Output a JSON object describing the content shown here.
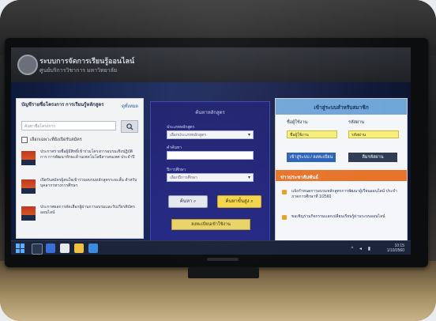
{
  "colors": {
    "center_panel": "#262a86",
    "right_header": "#6fa6d8",
    "orange_bar": "#e8742a",
    "yellow_button": "#f3d54a",
    "taskbar": "#1b2438"
  },
  "site": {
    "title": "ระบบการจัดการเรียนรู้ออนไลน์",
    "subtitle": "ศูนย์บริการวิชาการ มหาวิทยาลัย"
  },
  "left_panel": {
    "title": "บัญชีรายชื่อโครงการ การเรียนรู้หลักสูตร",
    "link": "ดูทั้งหมด",
    "search_placeholder": "ค้นหาชื่อโครงการ",
    "search_icon": "magnifier-icon",
    "checkbox_label": "เลือกเฉพาะที่ยังเปิดรับสมัคร",
    "news": [
      {
        "text": "ประกาศรายชื่อผู้มีสิทธิ์เข้าร่วมโครงการอบรมเชิงปฏิบัติการ การพัฒนาทักษะด้านเทคโนโลยีสารสนเทศ ประจำปี"
      },
      {
        "text": "เปิดรับสมัครผู้สนใจเข้าร่วมอบรมหลักสูตรระยะสั้น สำหรับบุคลากรทางการศึกษา"
      },
      {
        "text": "ประกาศผลการคัดเลือกผู้ผ่านการอบรมและรับเกียรติบัตรออนไลน์"
      }
    ]
  },
  "center_panel": {
    "title": "ค้นหาหลักสูตร",
    "label_category": "ประเภทหลักสูตร",
    "select_category": "เลือกประเภทหลักสูตร",
    "label_keyword": "คำค้นหา",
    "label_year": "ปีการศึกษา",
    "select_year": "เลือกปีการศึกษา",
    "search_button": "ค้นหา",
    "advanced_button": "ค้นหาขั้นสูง",
    "register_button": "ลงทะเบียนเข้าใช้งาน"
  },
  "right_panel": {
    "title": "เข้าสู่ระบบสำหรับสมาชิก",
    "username_label": "ชื่อผู้ใช้งาน",
    "password_label": "รหัสผ่าน",
    "username_value": "ชื่อผู้ใช้งาน",
    "password_value": "รหัสผ่าน",
    "login_button": "เข้าสู่ระบบ / ลงทะเบียน",
    "forgot_button": "ลืมรหัสผ่าน",
    "bar_title": "ข่าวประชาสัมพันธ์",
    "items": [
      {
        "text": "แจ้งกำหนดการอบรมหลักสูตรการพัฒนาผู้เรียนออนไลน์ ประจำภาคการศึกษาที่ 1/2560"
      },
      {
        "text": "ขอเชิญร่วมกิจกรรมแลกเปลี่ยนเรียนรู้ผ่านระบบออนไลน์"
      }
    ]
  },
  "taskbar": {
    "time": "10:15",
    "date": "1/10/2560"
  }
}
